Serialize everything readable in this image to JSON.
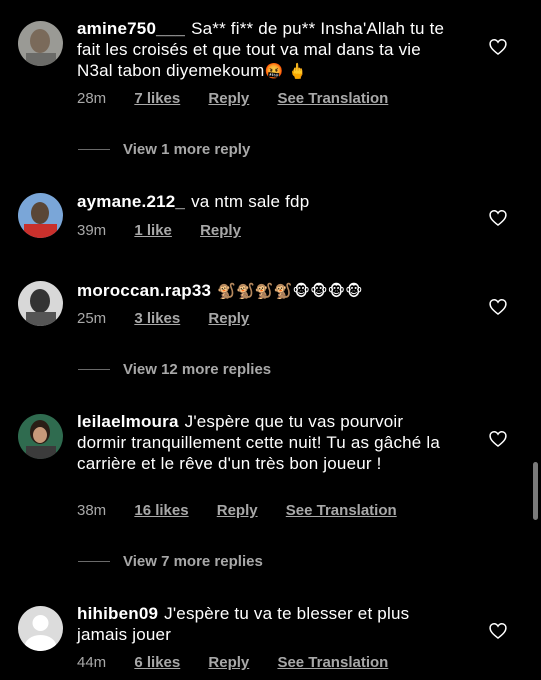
{
  "comments": [
    {
      "username": "amine750___",
      "text": "Sa** fi** de pu** Insha'Allah tu te fait les croisés et que tout va mal dans ta vie N3al tabon diyemekoum",
      "text_emoji": "🤬 🖕",
      "time": "28m",
      "likes": "7 likes",
      "reply": "Reply",
      "translate": "See Translation"
    },
    {
      "username": "aymane.212_",
      "text": "va ntm sale fdp",
      "time": "39m",
      "likes": "1 like",
      "reply": "Reply"
    },
    {
      "username": "moroccan.rap33",
      "text": "",
      "text_emoji": "🐒🐒🐒🐒🐵🐵🐵🐵",
      "time": "25m",
      "likes": "3 likes",
      "reply": "Reply"
    },
    {
      "username": "leilaelmoura",
      "text": "J'espère que tu vas pourvoir dormir tranquillement cette nuit!  Tu as gâché la carrière et le rêve d'un très bon joueur !",
      "time": "38m",
      "likes": "16 likes",
      "reply": "Reply",
      "translate": "See Translation"
    },
    {
      "username": "hihiben09",
      "text": "J'espère tu va te blesser et plus jamais jouer",
      "time": "44m",
      "likes": "6 likes",
      "reply": "Reply",
      "translate": "See Translation"
    }
  ],
  "view_more": [
    "View 1 more reply",
    "View 12 more replies",
    "View 7 more replies"
  ],
  "colors": {
    "background": "#000000",
    "text": "#ffffff",
    "muted": "#a8a8a8"
  }
}
